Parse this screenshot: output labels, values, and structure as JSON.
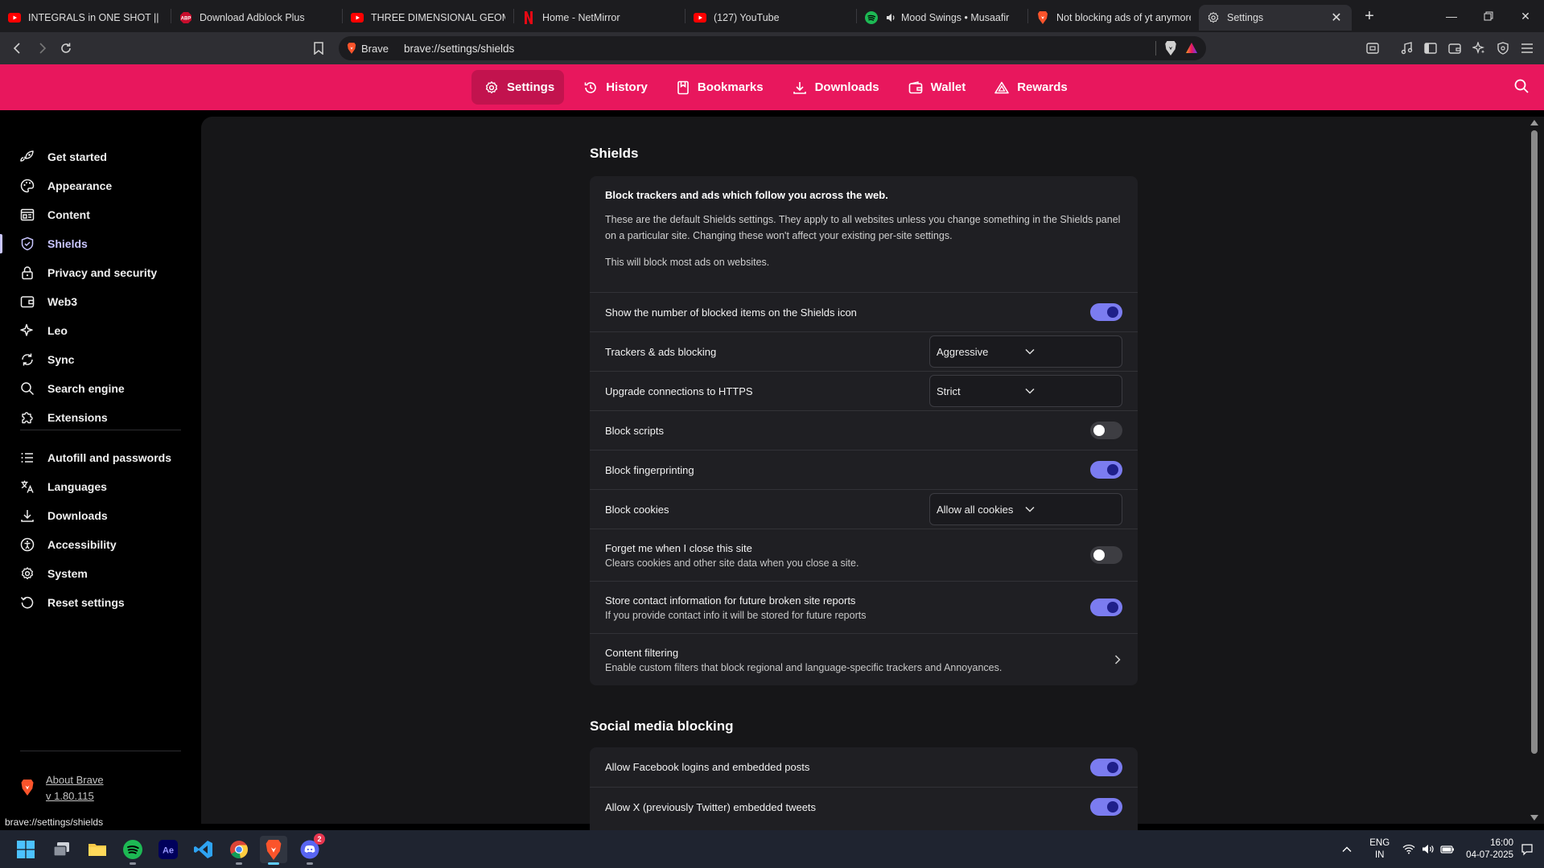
{
  "tabs": [
    {
      "title": "INTEGRALS in ONE SHOT || Full",
      "icon": "youtube-icon"
    },
    {
      "title": "Download Adblock Plus",
      "icon": "abp-icon"
    },
    {
      "title": "THREE DIMENSIONAL GEOMET",
      "icon": "youtube-icon"
    },
    {
      "title": "Home - NetMirror",
      "icon": "netflix-icon"
    },
    {
      "title": "(127) YouTube",
      "icon": "youtube-icon"
    },
    {
      "title": "Mood Swings • Musaafir",
      "icon": "spotify-icon"
    },
    {
      "title": "Not blocking ads of yt anymore",
      "icon": "brave-icon"
    },
    {
      "title": "Settings",
      "icon": "gear-icon"
    }
  ],
  "omnibox": {
    "brand": "Brave",
    "url": "brave://settings/shields"
  },
  "header_nav": [
    {
      "label": "Settings",
      "icon": "gear-icon"
    },
    {
      "label": "History",
      "icon": "history-icon"
    },
    {
      "label": "Bookmarks",
      "icon": "bookmark-icon"
    },
    {
      "label": "Downloads",
      "icon": "download-icon"
    },
    {
      "label": "Wallet",
      "icon": "wallet-icon"
    },
    {
      "label": "Rewards",
      "icon": "rewards-icon"
    }
  ],
  "sidebar": {
    "items": [
      {
        "label": "Get started",
        "icon": "rocket-icon"
      },
      {
        "label": "Appearance",
        "icon": "palette-icon"
      },
      {
        "label": "Content",
        "icon": "content-icon"
      },
      {
        "label": "Shields",
        "icon": "shield-icon"
      },
      {
        "label": "Privacy and security",
        "icon": "lock-icon"
      },
      {
        "label": "Web3",
        "icon": "wallet-icon"
      },
      {
        "label": "Leo",
        "icon": "sparkle-icon"
      },
      {
        "label": "Sync",
        "icon": "sync-icon"
      },
      {
        "label": "Search engine",
        "icon": "search-icon"
      },
      {
        "label": "Extensions",
        "icon": "puzzle-icon"
      },
      {
        "label": "Autofill and passwords",
        "icon": "list-icon"
      },
      {
        "label": "Languages",
        "icon": "translate-icon"
      },
      {
        "label": "Downloads",
        "icon": "download-icon"
      },
      {
        "label": "Accessibility",
        "icon": "accessibility-icon"
      },
      {
        "label": "System",
        "icon": "gear-icon"
      },
      {
        "label": "Reset settings",
        "icon": "reset-icon"
      }
    ],
    "about_label": "About Brave",
    "version": "v 1.80.115"
  },
  "shields": {
    "title": "Shields",
    "intro_head": "Block trackers and ads which follow you across the web.",
    "intro_p1": "These are the default Shields settings. They apply to all websites unless you change something in the Shields panel on a particular site. Changing these won't affect your existing per-site settings.",
    "intro_p2": "This will block most ads on websites.",
    "show_count": {
      "label": "Show the number of blocked items on the Shields icon",
      "on": true
    },
    "trackers": {
      "label": "Trackers & ads blocking",
      "value": "Aggressive"
    },
    "https": {
      "label": "Upgrade connections to HTTPS",
      "value": "Strict"
    },
    "block_scripts": {
      "label": "Block scripts",
      "on": false
    },
    "fingerprinting": {
      "label": "Block fingerprinting",
      "on": true
    },
    "cookies": {
      "label": "Block cookies",
      "value": "Allow all cookies"
    },
    "forget_me": {
      "label": "Forget me when I close this site",
      "sub": "Clears cookies and other site data when you close a site.",
      "on": false
    },
    "store_contact": {
      "label": "Store contact information for future broken site reports",
      "sub": "If you provide contact info it will be stored for future reports",
      "on": true
    },
    "content_filtering": {
      "label": "Content filtering",
      "sub": "Enable custom filters that block regional and language-specific trackers and Annoyances."
    }
  },
  "social": {
    "title": "Social media blocking",
    "facebook": {
      "label": "Allow Facebook logins and embedded posts",
      "on": true
    },
    "twitter": {
      "label": "Allow X (previously Twitter) embedded tweets",
      "on": true
    }
  },
  "status_url": "brave://settings/shields",
  "taskbar": {
    "lang_top": "ENG",
    "lang_bottom": "IN",
    "time": "16:00",
    "date": "04-07-2025",
    "discord_badge": "2"
  },
  "colors": {
    "accent": "#e8175d",
    "toggle_on": "#7b7cf0",
    "active_sidebar": "#c9c6ff"
  }
}
